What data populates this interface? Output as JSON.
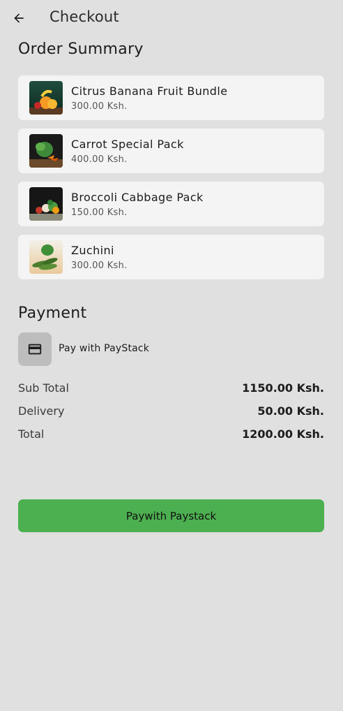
{
  "appbar": {
    "title": "Checkout"
  },
  "order_summary": {
    "title": "Order Summary",
    "items": [
      {
        "name": "Citrus Banana Fruit Bundle",
        "price": "300.00 Ksh."
      },
      {
        "name": "Carrot Special Pack",
        "price": "400.00 Ksh."
      },
      {
        "name": "Broccoli Cabbage Pack",
        "price": "150.00 Ksh."
      },
      {
        "name": "Zuchini",
        "price": "300.00 Ksh."
      }
    ]
  },
  "payment": {
    "title": "Payment",
    "method_label": "Pay with PayStack",
    "method_icon": "credit-card-icon"
  },
  "totals": {
    "subtotal_label": "Sub Total",
    "subtotal_value": "1150.00 Ksh.",
    "delivery_label": "Delivery",
    "delivery_value": "50.00 Ksh.",
    "total_label": "Total",
    "total_value": "1200.00 Ksh."
  },
  "pay_button": {
    "label": "Paywith Paystack",
    "color": "#4caf50"
  }
}
